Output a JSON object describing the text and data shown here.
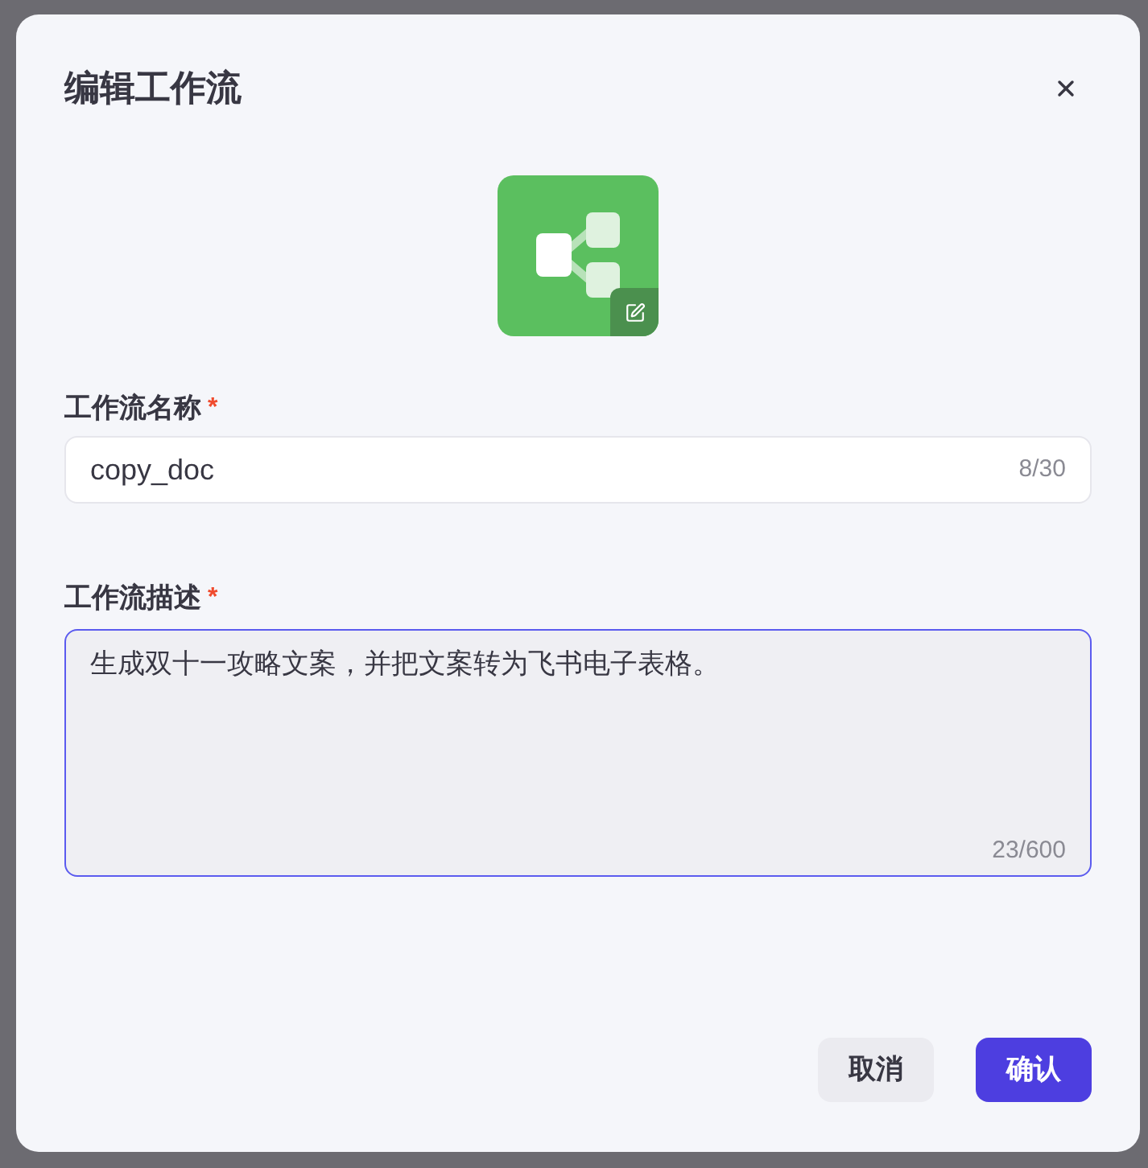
{
  "dialog": {
    "title": "编辑工作流"
  },
  "fields": [
    {
      "kind": "input",
      "label": "工作流名称",
      "required_mark": "*",
      "value": "copy_doc",
      "counter": "8/30",
      "focused": false
    },
    {
      "kind": "textarea",
      "label": "工作流描述",
      "required_mark": "*",
      "value": "生成双十一攻略文案，并把文案转为飞书电子表格。",
      "counter": "23/600",
      "focused": true
    }
  ],
  "buttons": [
    {
      "kind": "secondary",
      "label": "取消"
    },
    {
      "kind": "primary",
      "label": "确认"
    }
  ]
}
